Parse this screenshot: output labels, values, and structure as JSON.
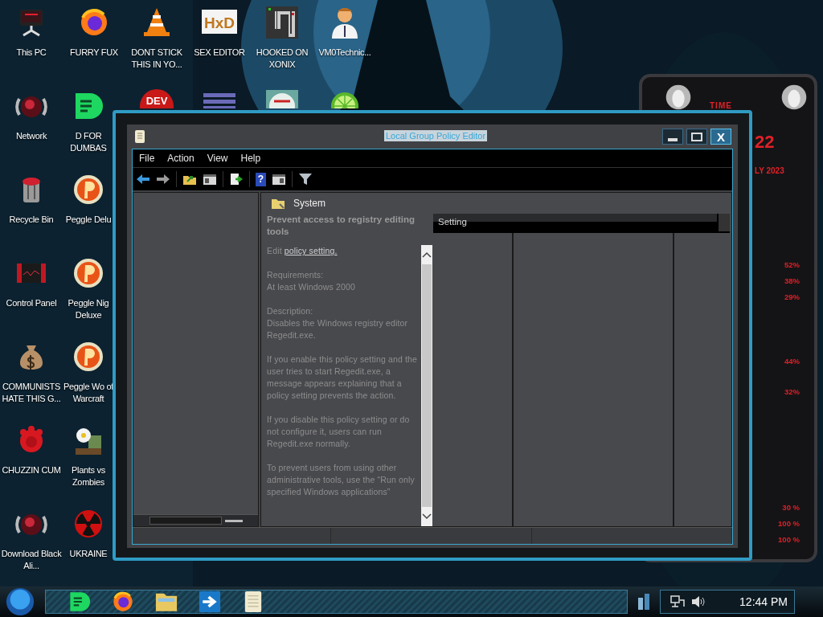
{
  "desktop": {
    "columns": [
      [
        {
          "label": "This PC"
        },
        {
          "label": "Network"
        },
        {
          "label": "Recycle Bin"
        },
        {
          "label": "Control Panel"
        },
        {
          "label": "COMMUNISTS HATE THIS G..."
        },
        {
          "label": "CHUZZIN CUM"
        },
        {
          "label": "Download Black Ali..."
        }
      ],
      [
        {
          "label": "FURRY FUX"
        },
        {
          "label": "D FOR DUMBAS"
        },
        {
          "label": "Peggle Delu"
        },
        {
          "label": "Peggle Nig Deluxe"
        },
        {
          "label": "Peggle Wo of Warcraft"
        },
        {
          "label": "Plants vs Zombies"
        },
        {
          "label": "UKRAINE"
        }
      ],
      [
        {
          "label": "DONT STICK THIS IN YO..."
        },
        {
          "badge": "DEV"
        }
      ],
      [
        {
          "label": "SEX EDITOR",
          "badge": "HxD"
        },
        {}
      ],
      [
        {
          "label": "HOOKED ON XONIX"
        },
        {}
      ],
      [
        {
          "label": "VM0Technic..."
        },
        {}
      ]
    ]
  },
  "gadget": {
    "title": "TIME",
    "day": "22",
    "month": "LY 2023",
    "readings": [
      [
        "52%",
        "38%",
        "29%"
      ],
      [
        "44%",
        "32%"
      ],
      [
        "30 %",
        "100 %",
        "100 %"
      ]
    ]
  },
  "window": {
    "title": "Local Group Policy Editor",
    "close_glyph": "X",
    "menu": [
      "File",
      "Action",
      "View",
      "Help"
    ],
    "toolbar": {
      "help_glyph": "?"
    },
    "node": "System",
    "description": {
      "title": "Prevent access to registry editing tools",
      "edit_prefix": "Edit",
      "edit_link": "policy setting.",
      "sections": [
        {
          "heading": "Requirements:",
          "text": "At least Windows 2000"
        },
        {
          "heading": "Description:",
          "text": "Disables the Windows registry editor Regedit.exe."
        },
        {
          "text": "If you enable this policy setting and the user tries to start Regedit.exe, a message appears explaining that a policy setting prevents the action."
        },
        {
          "text": "If you disable this policy setting or do not configure it, users can run Regedit.exe normally."
        },
        {
          "text": "To prevent users from using other administrative tools, use the “Run only specified Windows applications”"
        }
      ]
    },
    "list": {
      "columns": [
        "Setting"
      ]
    }
  },
  "taskbar": {
    "clock": "12:44 PM"
  }
}
